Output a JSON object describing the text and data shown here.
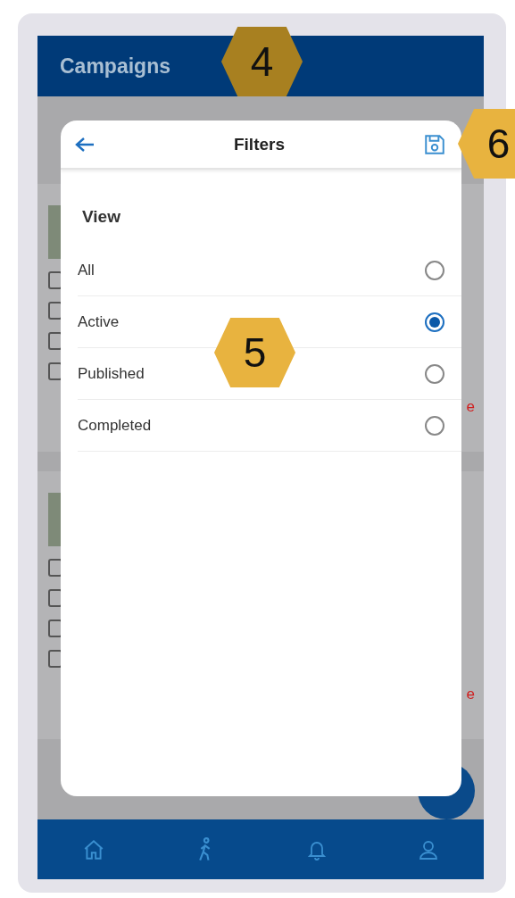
{
  "header": {
    "title": "Campaigns"
  },
  "filters": {
    "title": "Filters",
    "section": "View",
    "options": [
      {
        "label": "All",
        "selected": false
      },
      {
        "label": "Active",
        "selected": true
      },
      {
        "label": "Published",
        "selected": false
      },
      {
        "label": "Completed",
        "selected": false
      }
    ]
  },
  "background_cards": [
    {
      "action": "e"
    },
    {
      "action": "e"
    }
  ],
  "nav": [
    {
      "kind": "home"
    },
    {
      "kind": "walk"
    },
    {
      "kind": "bell"
    },
    {
      "kind": "user"
    }
  ],
  "callouts": [
    {
      "number": "4",
      "color": "#a88020"
    },
    {
      "number": "5",
      "color": "#e8b33f"
    },
    {
      "number": "6",
      "color": "#e8b33f"
    }
  ]
}
